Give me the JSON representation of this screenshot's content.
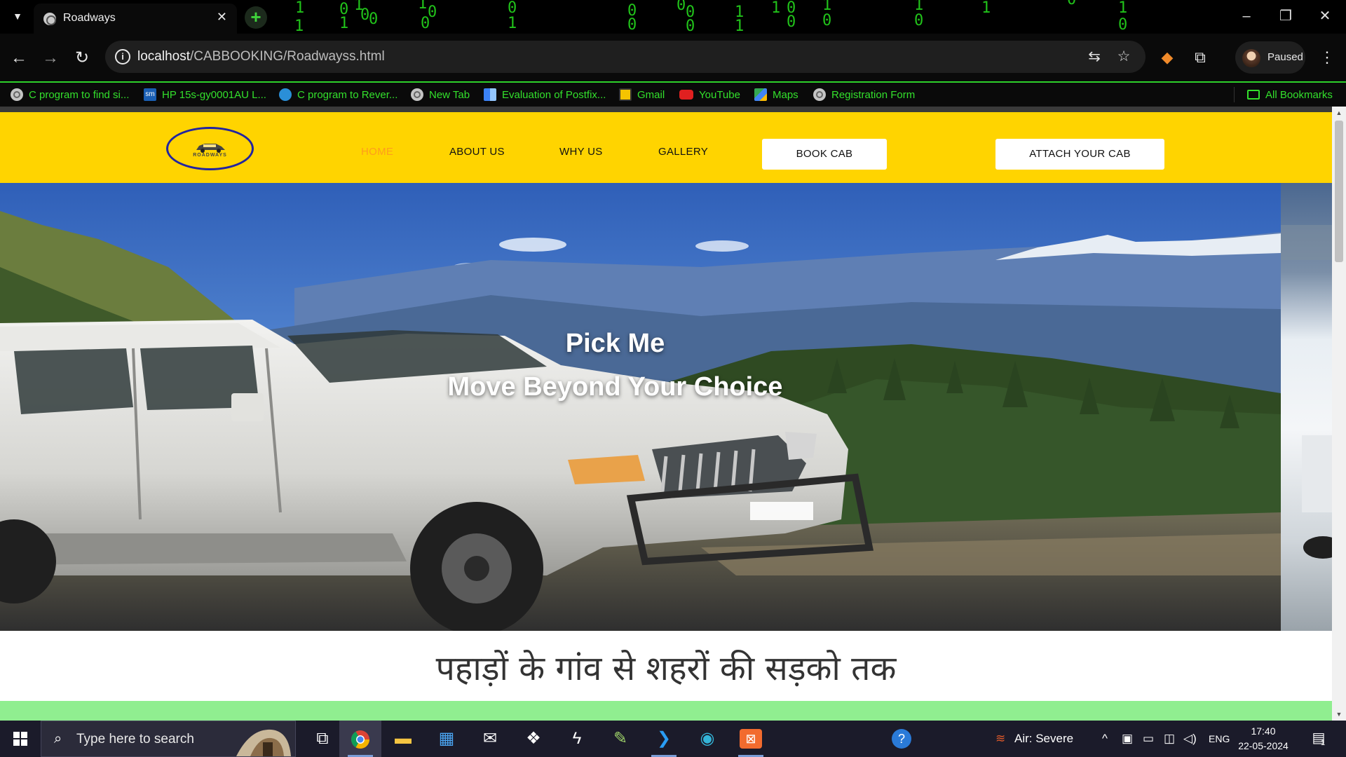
{
  "browser": {
    "tab": {
      "title": "Roadways",
      "close": "✕"
    },
    "new_tab": "+",
    "url": {
      "host": "localhost",
      "path": "/CABBOOKING/Roadwayss.html"
    },
    "profile": {
      "label": "Paused"
    }
  },
  "bookmarks": [
    {
      "label": "C program to find si...",
      "icon": "globe-icon"
    },
    {
      "label": "HP 15s-gy0001AU L...",
      "icon": "sm-icon"
    },
    {
      "label": "C program to Rever...",
      "icon": "site-icon"
    },
    {
      "label": "New Tab",
      "icon": "globe-icon"
    },
    {
      "label": "Evaluation of Postfix...",
      "icon": "grid-icon"
    },
    {
      "label": "Gmail",
      "icon": "gmail-icon"
    },
    {
      "label": "YouTube",
      "icon": "youtube-icon"
    },
    {
      "label": "Maps",
      "icon": "maps-icon"
    },
    {
      "label": "Registration Form",
      "icon": "globe-icon"
    }
  ],
  "all_bookmarks": "All Bookmarks",
  "site": {
    "logo_text": "ROADWAYS",
    "nav": {
      "home": "HOME",
      "about": "ABOUT US",
      "why": "WHY US",
      "gallery": "GALLERY",
      "book": "BOOK CAB",
      "attach": "ATTACH YOUR CAB"
    },
    "hero": {
      "line1": "Pick Me",
      "line2": "Move Beyond Your Choice"
    },
    "tagline": "पहाड़ों के गांव से शहरों की सड़को तक"
  },
  "taskbar": {
    "search_placeholder": "Type here to search",
    "weather": "Air: Severe",
    "language": "ENG",
    "time": "17:40",
    "date": "22-05-2024",
    "notifications": "1"
  },
  "colors": {
    "nav_yellow": "#ffd400",
    "nav_active": "#ff9d1c",
    "green_band": "#90ee90",
    "bookmark_green": "#33e02c"
  }
}
